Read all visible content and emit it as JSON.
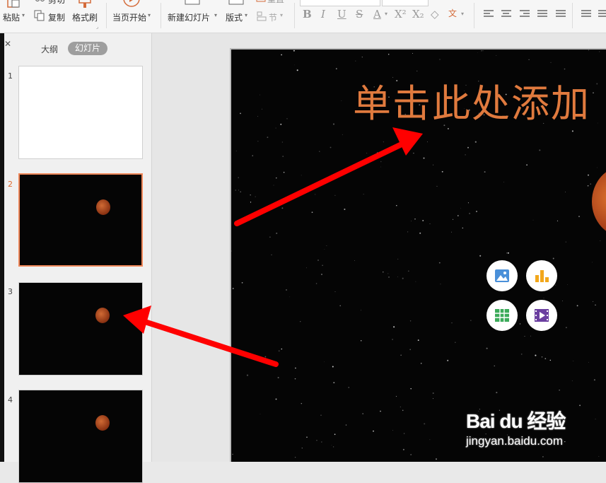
{
  "toolbar": {
    "paste_label": "粘贴",
    "cut_label": "剪切",
    "copy_label": "复制",
    "format_painter_label": "格式刷",
    "from_current_label": "当页开始",
    "new_slide_label": "新建幻灯片",
    "layout_label": "版式",
    "section_label": "节",
    "reset_label": "重置"
  },
  "panel": {
    "tab_outline": "大纲",
    "tab_slides": "幻灯片",
    "slides": [
      {
        "number": "1",
        "style": "white"
      },
      {
        "number": "2",
        "style": "black"
      },
      {
        "number": "3",
        "style": "black"
      },
      {
        "number": "4",
        "style": "black"
      }
    ],
    "selected_slide": "2"
  },
  "slide": {
    "title_placeholder": "单击此处添加",
    "placeholder_icons": [
      "picture-icon",
      "chart-icon",
      "table-icon",
      "video-icon"
    ]
  },
  "watermark": {
    "main": "Bai du 经验",
    "sub": "jingyan.baidu.com"
  },
  "colors": {
    "title": "#e07a3e",
    "arrow": "#ff0000",
    "selection": "#f0885a",
    "slide_bg": "#050505"
  }
}
